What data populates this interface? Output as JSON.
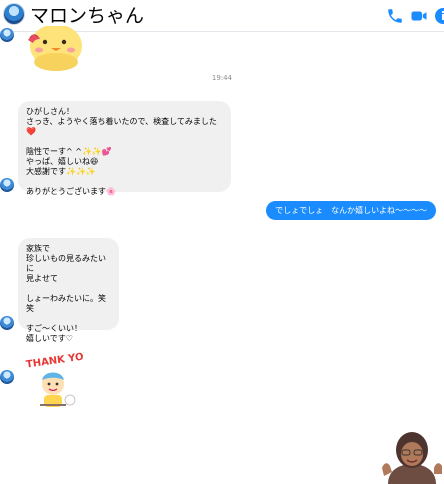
{
  "header": {
    "title": "マロンちゃん",
    "icons": [
      "phone-icon",
      "video-icon",
      "info-icon"
    ],
    "accent_color": "#1a8cff"
  },
  "timestamp": "19:44",
  "messages": {
    "in_1": "ひがしさん！\nさっき、ようやく落ち着いたので、検査してみました❤️\n\n陰性でーす^ ^✨✨💕\nやっぱ、嬉しいね😆\n大感謝です✨✨✨\n\nありがとうございます🌸",
    "out_1": "でしょでしょ　なんか嬉しいよね〜〜〜〜",
    "in_2": "家族で\n珍しいもの見るみたいに\n見よせて\n\nしょーわみたいに。笑笑\n\nすご〜くいい！\n嬉しいです♡"
  },
  "stickers": {
    "thank_you_text": "THANK YOU!"
  }
}
